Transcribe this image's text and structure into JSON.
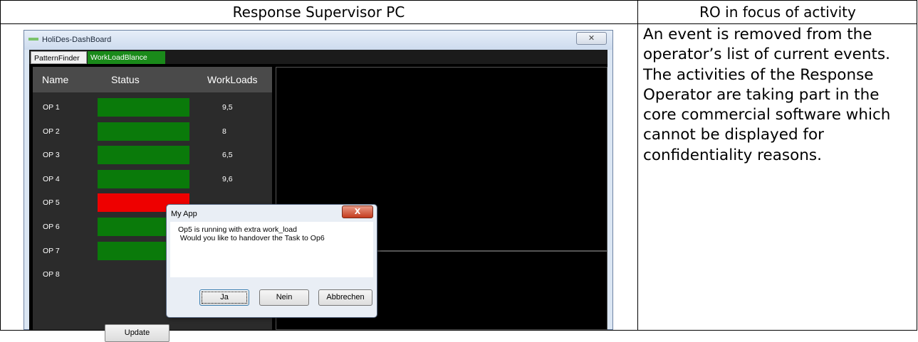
{
  "table": {
    "header_left": "Response Supervisor PC",
    "header_right": "RO in focus of activity",
    "description": "An event is removed from the operator’s list of current events. The activities of the Response Operator are taking part in the core commercial software which cannot be displayed for confidentiality reasons."
  },
  "window": {
    "title": "HoliDes-DashBoard",
    "close_glyph": "✕",
    "tabs": [
      "PatternFinder",
      "WorkLoadBlance"
    ],
    "active_tab": "WorkLoadBlance",
    "grid": {
      "headers": [
        "Name",
        "Status",
        "WorkLoads"
      ],
      "rows": [
        {
          "name": "OP 1",
          "status": "green",
          "workload": "9,5"
        },
        {
          "name": "OP 2",
          "status": "green",
          "workload": "8"
        },
        {
          "name": "OP 3",
          "status": "green",
          "workload": "6,5"
        },
        {
          "name": "OP 4",
          "status": "green",
          "workload": "9,6"
        },
        {
          "name": "OP 5",
          "status": "red",
          "workload": ""
        },
        {
          "name": "OP 6",
          "status": "green",
          "workload": ""
        },
        {
          "name": "OP 7",
          "status": "green",
          "workload": ""
        },
        {
          "name": "OP 8",
          "status": "none",
          "workload": ""
        }
      ]
    },
    "update_label": "Update"
  },
  "dialog": {
    "title": "My App",
    "close_glyph": "X",
    "message_line1": "Op5 is running with extra work_load",
    "message_line2": " Would you like to handover the Task to Op6",
    "buttons": [
      "Ja",
      "Nein",
      "Abbrechen"
    ]
  },
  "colors": {
    "status_green": "#0a7a0a",
    "status_red": "#ee0000",
    "tab_active": "#1a8a1a"
  }
}
